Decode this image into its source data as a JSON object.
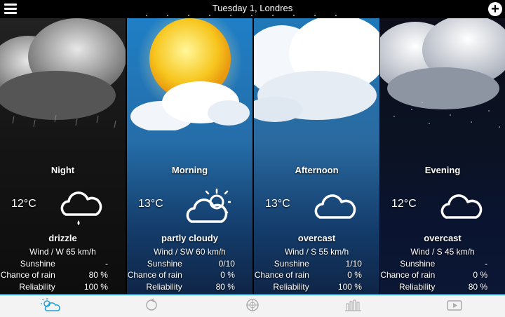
{
  "header": {
    "title": "Tuesday 1, Londres",
    "menu_icon": "menu-icon",
    "add_icon": "plus-icon"
  },
  "labels": {
    "sunshine": "Sunshine",
    "rain": "Chance of rain",
    "reliability": "Reliability"
  },
  "panels": [
    {
      "period": "Night",
      "temp": "12°C",
      "condition": "drizzle",
      "wind": "Wind / W 65 km/h",
      "sunshine": "-",
      "rain": "80 %",
      "reliability": "100 %",
      "icon": "cloud-drizzle-icon"
    },
    {
      "period": "Morning",
      "temp": "13°C",
      "condition": "partly cloudy",
      "wind": "Wind / SW 60 km/h",
      "sunshine": "0/10",
      "rain": "0 %",
      "reliability": "80 %",
      "icon": "partly-cloudy-icon"
    },
    {
      "period": "Afternoon",
      "temp": "13°C",
      "condition": "overcast",
      "wind": "Wind / S 55 km/h",
      "sunshine": "1/10",
      "rain": "0 %",
      "reliability": "100 %",
      "icon": "cloud-icon"
    },
    {
      "period": "Evening",
      "temp": "12°C",
      "condition": "overcast",
      "wind": "Wind / S 45 km/h",
      "sunshine": "-",
      "rain": "0 %",
      "reliability": "80 %",
      "icon": "cloud-icon"
    }
  ],
  "tabs": [
    {
      "icon": "weather-today-icon",
      "active": true
    },
    {
      "icon": "refresh-forecast-icon",
      "active": false
    },
    {
      "icon": "radar-icon",
      "active": false
    },
    {
      "icon": "bar-chart-icon",
      "active": false
    },
    {
      "icon": "video-icon",
      "active": false
    }
  ],
  "colors": {
    "accent": "#1ea0d6",
    "bar_background": "#f3f3f3"
  }
}
